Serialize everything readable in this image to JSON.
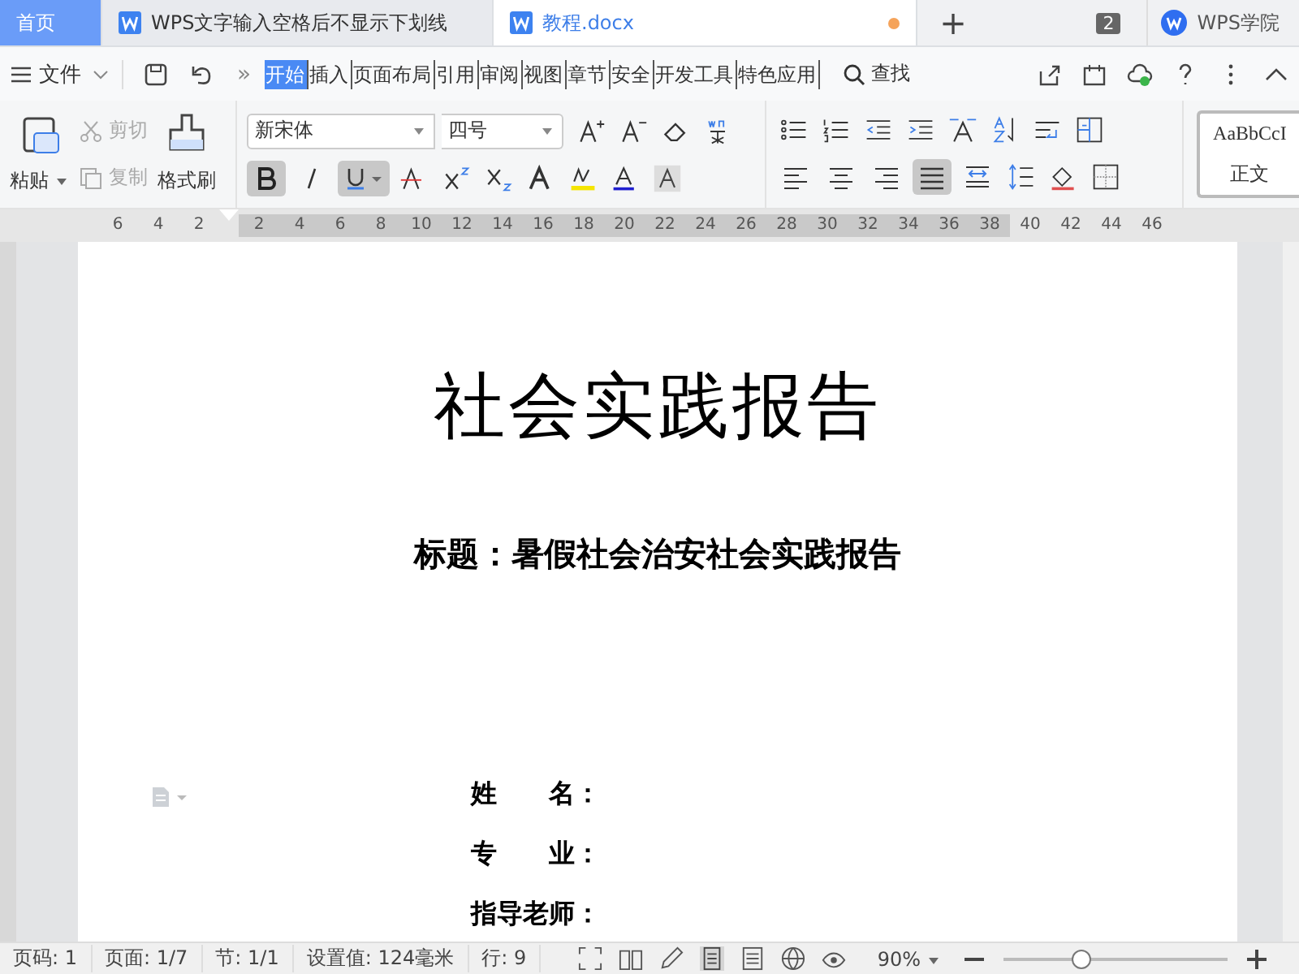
{
  "tabs": [
    {
      "label": "首页",
      "kind": "home",
      "selected": false,
      "modified": false
    },
    {
      "label": "WPS文字输入空格后不显示下划线",
      "kind": "doc",
      "selected": false,
      "modified": false
    },
    {
      "label": "教程.docx",
      "kind": "doc",
      "selected": true,
      "modified": true
    }
  ],
  "new_tab": "+",
  "window_count": "2",
  "account": "WPS学院",
  "menu": {
    "file": "文件",
    "more": "»",
    "items": [
      {
        "label": "开始",
        "selected": true
      },
      {
        "label": "插入",
        "selected": false
      },
      {
        "label": "页面布局",
        "selected": false
      },
      {
        "label": "引用",
        "selected": false
      },
      {
        "label": "审阅",
        "selected": false
      },
      {
        "label": "视图",
        "selected": false
      },
      {
        "label": "章节",
        "selected": false
      },
      {
        "label": "安全",
        "selected": false
      },
      {
        "label": "开发工具",
        "selected": false
      },
      {
        "label": "特色应用",
        "selected": false
      }
    ],
    "search": "查找"
  },
  "clipboard": {
    "paste": "粘贴",
    "cut": {
      "label": "剪切",
      "disabled": true
    },
    "copy": {
      "label": "复制",
      "disabled": true
    },
    "format_painter": "格式刷"
  },
  "font": {
    "family": "新宋体",
    "size": "四号",
    "bold": true,
    "italic": false,
    "underline": true
  },
  "alignment": {
    "left": false,
    "center": false,
    "right": false,
    "justify": true,
    "distributed": false
  },
  "style": {
    "preview": "AaBbCcI",
    "name": "正文"
  },
  "ruler": {
    "left_ticks": [
      "6",
      "4",
      "2"
    ],
    "right_ticks": [
      "2",
      "4",
      "6",
      "8",
      "10",
      "12",
      "14",
      "16",
      "18",
      "20",
      "22",
      "24",
      "26",
      "28",
      "30",
      "32",
      "34",
      "36",
      "38",
      "40",
      "42",
      "44",
      "46"
    ]
  },
  "document": {
    "title": "社会实践报告",
    "subtitle": "标题：暑假社会治安社会实践报告",
    "fields": [
      "姓　　名：",
      "专　　业：",
      "指导老师："
    ]
  },
  "status_bar": {
    "items": [
      "页码: 1",
      "页面: 1/7",
      "节: 1/1",
      "设置值: 124毫米",
      "行: 9"
    ],
    "zoom": "90%",
    "zoom_slider": {
      "level": 0.35
    }
  }
}
